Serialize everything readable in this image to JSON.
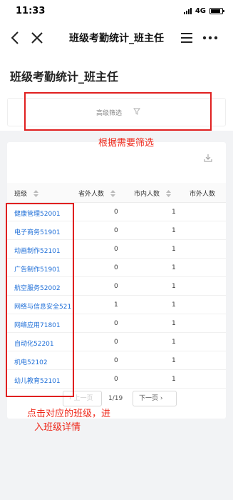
{
  "status_bar": {
    "time": "11:33",
    "network": "4G",
    "battery_level": 0.85
  },
  "nav": {
    "title": "班级考勤统计_班主任",
    "icons": [
      "back-arrow-icon",
      "close-icon",
      "menu-icon",
      "more-icon"
    ]
  },
  "page_title": "班级考勤统计_班主任",
  "filter": {
    "label": "高级筛选"
  },
  "table": {
    "columns": [
      "班级",
      "省外人数",
      "市内人数",
      "市外人数"
    ],
    "rows": [
      {
        "class_name": "健康管理52001",
        "out_of_province": "0",
        "in_city": "1"
      },
      {
        "class_name": "电子商务51901",
        "out_of_province": "0",
        "in_city": "1"
      },
      {
        "class_name": "动画制作52101",
        "out_of_province": "0",
        "in_city": "1"
      },
      {
        "class_name": "广告制作51901",
        "out_of_province": "0",
        "in_city": "1"
      },
      {
        "class_name": "航空服务52002",
        "out_of_province": "0",
        "in_city": "1"
      },
      {
        "class_name": "网络与信息安全521",
        "out_of_province": "1",
        "in_city": "1"
      },
      {
        "class_name": "网络应用71801",
        "out_of_province": "0",
        "in_city": "1"
      },
      {
        "class_name": "自动化52201",
        "out_of_province": "0",
        "in_city": "1"
      },
      {
        "class_name": "机电52102",
        "out_of_province": "0",
        "in_city": "1"
      },
      {
        "class_name": "幼儿教育52101",
        "out_of_province": "0",
        "in_city": "1"
      }
    ]
  },
  "pagination": {
    "prev_label": "上一页",
    "page_info": "1/19",
    "next_label": "下一页"
  },
  "annotations": {
    "filter_note": "根据需要筛选",
    "class_note_line1": "点击对应的班级，进",
    "class_note_line2": "入班级详情",
    "color": "#e02020"
  },
  "colors": {
    "link": "#1f6fd8",
    "background_gray": "#f2f3f5"
  }
}
